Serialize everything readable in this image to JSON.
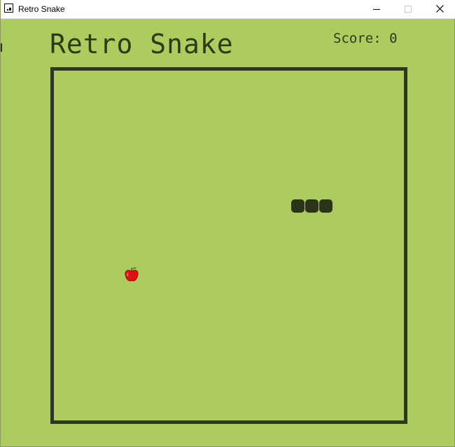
{
  "window": {
    "title": "Retro Snake",
    "icon": "app-icon",
    "controls": [
      "minimize-icon",
      "maximize-icon",
      "close-icon"
    ]
  },
  "game": {
    "title": "Retro Snake",
    "score_text": "Score: 0",
    "score": 0
  },
  "board": {
    "snake_segments": 3,
    "food": "apple-icon"
  },
  "colors": {
    "background": "#adcc60",
    "ink": "#2d3a18",
    "snake": "#2c3318",
    "apple": "#e01010"
  }
}
